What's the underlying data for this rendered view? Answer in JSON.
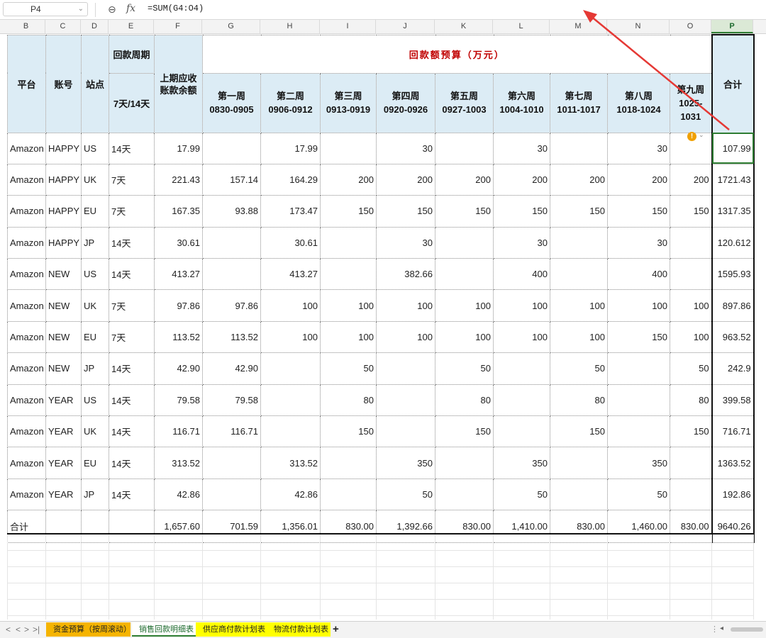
{
  "formula_bar": {
    "cell_ref": "P4",
    "formula": "=SUM(G4:O4)"
  },
  "columns": [
    "B",
    "C",
    "D",
    "E",
    "F",
    "G",
    "H",
    "I",
    "J",
    "K",
    "L",
    "M",
    "N",
    "O",
    "P"
  ],
  "selected_column": "P",
  "header": {
    "platform": "平台",
    "account": "账号",
    "site": "站点",
    "period": "回款周期",
    "period_values": "7天/14天",
    "prev_balance": "上期应收账款余额",
    "title": "回款额预算（万元）",
    "total": "合计",
    "weeks": [
      {
        "name": "第一周",
        "range": "0830-0905"
      },
      {
        "name": "第二周",
        "range": "0906-0912"
      },
      {
        "name": "第三周",
        "range": "0913-0919"
      },
      {
        "name": "第四周",
        "range": "0920-0926"
      },
      {
        "name": "第五周",
        "range": "0927-1003"
      },
      {
        "name": "第六周",
        "range": "1004-1010"
      },
      {
        "name": "第七周",
        "range": "1011-1017"
      },
      {
        "name": "第八周",
        "range": "1018-1024"
      },
      {
        "name": "第九周",
        "range": "1025-1031"
      }
    ]
  },
  "rows": [
    {
      "platform": "Amazon",
      "account": "HAPPY",
      "site": "US",
      "period": "14天",
      "balance": "17.99",
      "weeks": [
        "",
        "17.99",
        "",
        "30",
        "",
        "30",
        "",
        "30",
        ""
      ],
      "total": "107.99"
    },
    {
      "platform": "Amazon",
      "account": "HAPPY",
      "site": "UK",
      "period": "7天",
      "balance": "221.43",
      "weeks": [
        "157.14",
        "164.29",
        "200",
        "200",
        "200",
        "200",
        "200",
        "200",
        "200"
      ],
      "total": "1721.43"
    },
    {
      "platform": "Amazon",
      "account": "HAPPY",
      "site": "EU",
      "period": "7天",
      "balance": "167.35",
      "weeks": [
        "93.88",
        "173.47",
        "150",
        "150",
        "150",
        "150",
        "150",
        "150",
        "150"
      ],
      "total": "1317.35"
    },
    {
      "platform": "Amazon",
      "account": "HAPPY",
      "site": "JP",
      "period": "14天",
      "balance": "30.61",
      "weeks": [
        "",
        "30.61",
        "",
        "30",
        "",
        "30",
        "",
        "30",
        ""
      ],
      "total": "120.612"
    },
    {
      "platform": "Amazon",
      "account": "NEW",
      "site": "US",
      "period": "14天",
      "balance": "413.27",
      "weeks": [
        "",
        "413.27",
        "",
        "382.66",
        "",
        "400",
        "",
        "400",
        ""
      ],
      "total": "1595.93"
    },
    {
      "platform": "Amazon",
      "account": "NEW",
      "site": "UK",
      "period": "7天",
      "balance": "97.86",
      "weeks": [
        "97.86",
        "100",
        "100",
        "100",
        "100",
        "100",
        "100",
        "100",
        "100"
      ],
      "total": "897.86"
    },
    {
      "platform": "Amazon",
      "account": "NEW",
      "site": "EU",
      "period": "7天",
      "balance": "113.52",
      "weeks": [
        "113.52",
        "100",
        "100",
        "100",
        "100",
        "100",
        "100",
        "150",
        "100"
      ],
      "total": "963.52"
    },
    {
      "platform": "Amazon",
      "account": "NEW",
      "site": "JP",
      "period": "14天",
      "balance": "42.90",
      "weeks": [
        "42.90",
        "",
        "50",
        "",
        "50",
        "",
        "50",
        "",
        "50"
      ],
      "total": "242.9"
    },
    {
      "platform": "Amazon",
      "account": "YEAR",
      "site": "US",
      "period": "14天",
      "balance": "79.58",
      "weeks": [
        "79.58",
        "",
        "80",
        "",
        "80",
        "",
        "80",
        "",
        "80"
      ],
      "total": "399.58"
    },
    {
      "platform": "Amazon",
      "account": "YEAR",
      "site": "UK",
      "period": "14天",
      "balance": "116.71",
      "weeks": [
        "116.71",
        "",
        "150",
        "",
        "150",
        "",
        "150",
        "",
        "150"
      ],
      "total": "716.71"
    },
    {
      "platform": "Amazon",
      "account": "YEAR",
      "site": "EU",
      "period": "14天",
      "balance": "313.52",
      "weeks": [
        "",
        "313.52",
        "",
        "350",
        "",
        "350",
        "",
        "350",
        ""
      ],
      "total": "1363.52"
    },
    {
      "platform": "Amazon",
      "account": "YEAR",
      "site": "JP",
      "period": "14天",
      "balance": "42.86",
      "weeks": [
        "",
        "42.86",
        "",
        "50",
        "",
        "50",
        "",
        "50",
        ""
      ],
      "total": "192.86"
    }
  ],
  "totals": {
    "label": "合计",
    "balance": "1,657.60",
    "weeks": [
      "701.59",
      "1,356.01",
      "830.00",
      "1,392.66",
      "830.00",
      "1,410.00",
      "830.00",
      "1,460.00",
      "830.00"
    ],
    "total": "9640.26"
  },
  "sheet_tabs": [
    {
      "label": "资金预算（按周滚动）",
      "color": "#f5b400",
      "active": false
    },
    {
      "label": "销售回款明细表",
      "color": "#ffffff",
      "active": true
    },
    {
      "label": "供应商付款计划表",
      "color": "#ffff00",
      "active": false
    },
    {
      "label": "物流付款计划表",
      "color": "#ffff00",
      "active": false
    }
  ],
  "colors": {
    "header_fill": "#dcecf5",
    "title_text": "#c00000",
    "selection": "#2e7d32",
    "annotation_arrow": "#e53935"
  }
}
